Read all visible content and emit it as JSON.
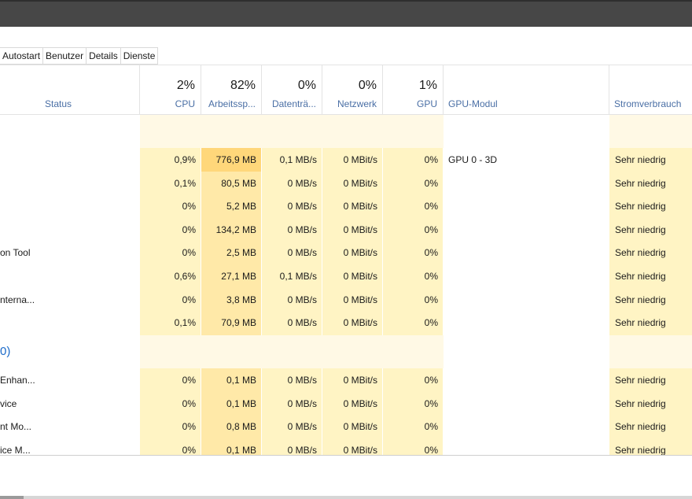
{
  "tabs": [
    "Autostart",
    "Benutzer",
    "Details",
    "Dienste"
  ],
  "header": {
    "status_label": "Status",
    "cpu": {
      "pct": "2%",
      "label": "CPU"
    },
    "mem": {
      "pct": "82%",
      "label": "Arbeitssp..."
    },
    "disk": {
      "pct": "0%",
      "label": "Datenträ..."
    },
    "net": {
      "pct": "0%",
      "label": "Netzwerk"
    },
    "gpu": {
      "pct": "1%",
      "label": "GPU"
    },
    "gpu_engine_label": "GPU-Modul",
    "power_label": "Stromverbrauch"
  },
  "group_label": "0)",
  "rows": [
    {
      "name": "",
      "cpu": "0,9%",
      "mem": "776,9 MB",
      "disk": "0,1 MB/s",
      "net": "0 MBit/s",
      "gpu": "0%",
      "engine": "GPU 0 - 3D",
      "power": "Sehr niedrig"
    },
    {
      "name": "",
      "cpu": "0,1%",
      "mem": "80,5 MB",
      "disk": "0 MB/s",
      "net": "0 MBit/s",
      "gpu": "0%",
      "engine": "",
      "power": "Sehr niedrig"
    },
    {
      "name": "",
      "cpu": "0%",
      "mem": "5,2 MB",
      "disk": "0 MB/s",
      "net": "0 MBit/s",
      "gpu": "0%",
      "engine": "",
      "power": "Sehr niedrig"
    },
    {
      "name": "",
      "cpu": "0%",
      "mem": "134,2 MB",
      "disk": "0 MB/s",
      "net": "0 MBit/s",
      "gpu": "0%",
      "engine": "",
      "power": "Sehr niedrig"
    },
    {
      "name": "on Tool",
      "cpu": "0%",
      "mem": "2,5 MB",
      "disk": "0 MB/s",
      "net": "0 MBit/s",
      "gpu": "0%",
      "engine": "",
      "power": "Sehr niedrig"
    },
    {
      "name": "",
      "cpu": "0,6%",
      "mem": "27,1 MB",
      "disk": "0,1 MB/s",
      "net": "0 MBit/s",
      "gpu": "0%",
      "engine": "",
      "power": "Sehr niedrig"
    },
    {
      "name": "nterna...",
      "cpu": "0%",
      "mem": "3,8 MB",
      "disk": "0 MB/s",
      "net": "0 MBit/s",
      "gpu": "0%",
      "engine": "",
      "power": "Sehr niedrig"
    },
    {
      "name": "",
      "cpu": "0,1%",
      "mem": "70,9 MB",
      "disk": "0 MB/s",
      "net": "0 MBit/s",
      "gpu": "0%",
      "engine": "",
      "power": "Sehr niedrig"
    }
  ],
  "rows2": [
    {
      "name": "Enhan...",
      "cpu": "0%",
      "mem": "0,1 MB",
      "disk": "0 MB/s",
      "net": "0 MBit/s",
      "gpu": "0%",
      "engine": "",
      "power": "Sehr niedrig"
    },
    {
      "name": "vice",
      "cpu": "0%",
      "mem": "0,1 MB",
      "disk": "0 MB/s",
      "net": "0 MBit/s",
      "gpu": "0%",
      "engine": "",
      "power": "Sehr niedrig"
    },
    {
      "name": "nt Mo...",
      "cpu": "0%",
      "mem": "0,8 MB",
      "disk": "0 MB/s",
      "net": "0 MBit/s",
      "gpu": "0%",
      "engine": "",
      "power": "Sehr niedrig"
    },
    {
      "name": "ice M...",
      "cpu": "0%",
      "mem": "0,1 MB",
      "disk": "0 MB/s",
      "net": "0 MBit/s",
      "gpu": "0%",
      "engine": "",
      "power": "Sehr niedrig"
    }
  ],
  "colors": {
    "highlight": "#ffd77a",
    "light": "#fff4c4",
    "mem": "#ffe9a8",
    "accent": "#1b6ac9"
  }
}
